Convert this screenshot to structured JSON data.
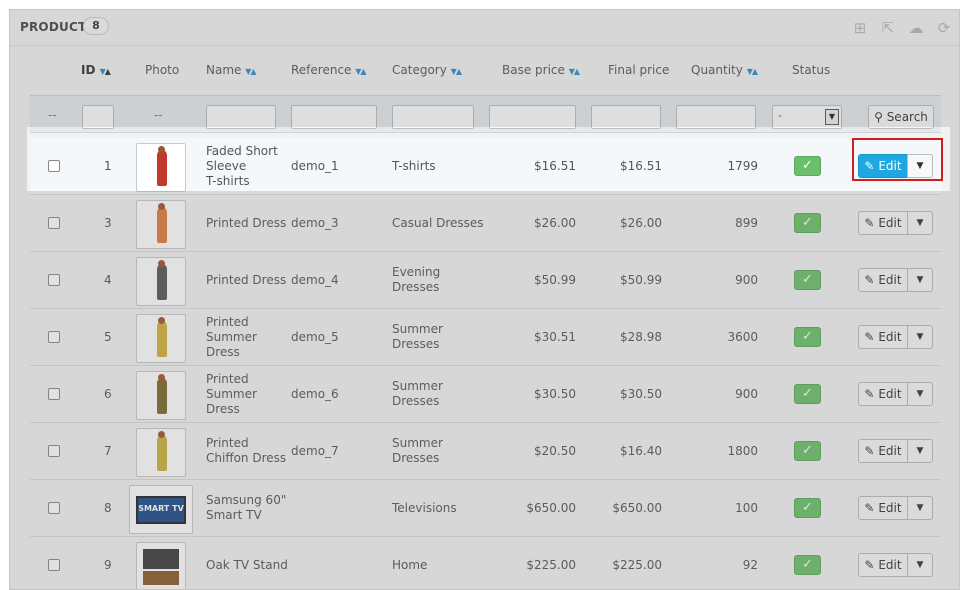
{
  "panel": {
    "title": "PRODUCTS",
    "count": "8"
  },
  "toolbar": [
    {
      "name": "add-new-icon",
      "glyph": "⊞"
    },
    {
      "name": "export-icon",
      "glyph": "⇱"
    },
    {
      "name": "cloud-upload-icon",
      "glyph": "☁"
    },
    {
      "name": "refresh-icon",
      "glyph": "⟳"
    }
  ],
  "columns": {
    "id": "ID",
    "photo": "Photo",
    "name": "Name",
    "reference": "Reference",
    "category": "Category",
    "base_price": "Base price",
    "final_price": "Final price",
    "quantity": "Quantity",
    "status": "Status"
  },
  "filters": {
    "dash": "--",
    "status_selected": "-",
    "search_label": "Search"
  },
  "rows": [
    {
      "id": "1",
      "name": [
        "Faded Short",
        "Sleeve",
        "T-shirts"
      ],
      "reference": "demo_1",
      "category": [
        "T-shirts"
      ],
      "base": "$16.51",
      "final": "$16.51",
      "qty": "1799",
      "edit": "Edit"
    },
    {
      "id": "3",
      "name": [
        "Printed Dress"
      ],
      "reference": "demo_3",
      "category": [
        "Casual Dresses"
      ],
      "base": "$26.00",
      "final": "$26.00",
      "qty": "899",
      "edit": "Edit"
    },
    {
      "id": "4",
      "name": [
        "Printed Dress"
      ],
      "reference": "demo_4",
      "category": [
        "Evening",
        "Dresses"
      ],
      "base": "$50.99",
      "final": "$50.99",
      "qty": "900",
      "edit": "Edit"
    },
    {
      "id": "5",
      "name": [
        "Printed",
        "Summer",
        "Dress"
      ],
      "reference": "demo_5",
      "category": [
        "Summer",
        "Dresses"
      ],
      "base": "$30.51",
      "final": "$28.98",
      "qty": "3600",
      "edit": "Edit"
    },
    {
      "id": "6",
      "name": [
        "Printed",
        "Summer",
        "Dress"
      ],
      "reference": "demo_6",
      "category": [
        "Summer",
        "Dresses"
      ],
      "base": "$30.50",
      "final": "$30.50",
      "qty": "900",
      "edit": "Edit"
    },
    {
      "id": "7",
      "name": [
        "Printed",
        "Chiffon Dress"
      ],
      "reference": "demo_7",
      "category": [
        "Summer",
        "Dresses"
      ],
      "base": "$20.50",
      "final": "$16.40",
      "qty": "1800",
      "edit": "Edit"
    },
    {
      "id": "8",
      "name": [
        "Samsung 60\"",
        "Smart TV"
      ],
      "reference": "",
      "category": [
        "Televisions"
      ],
      "base": "$650.00",
      "final": "$650.00",
      "qty": "100",
      "edit": "Edit"
    },
    {
      "id": "9",
      "name": [
        "Oak TV Stand"
      ],
      "reference": "",
      "category": [
        "Home"
      ],
      "base": "$225.00",
      "final": "$225.00",
      "qty": "92",
      "edit": "Edit"
    }
  ],
  "tv_logo_text": "SMART TV",
  "colors": {
    "primary": "#1fa8e0",
    "status_ok": "#6ac06a",
    "highlight": "#cc1f1f",
    "sort_arrow": "#2a8fcf"
  }
}
